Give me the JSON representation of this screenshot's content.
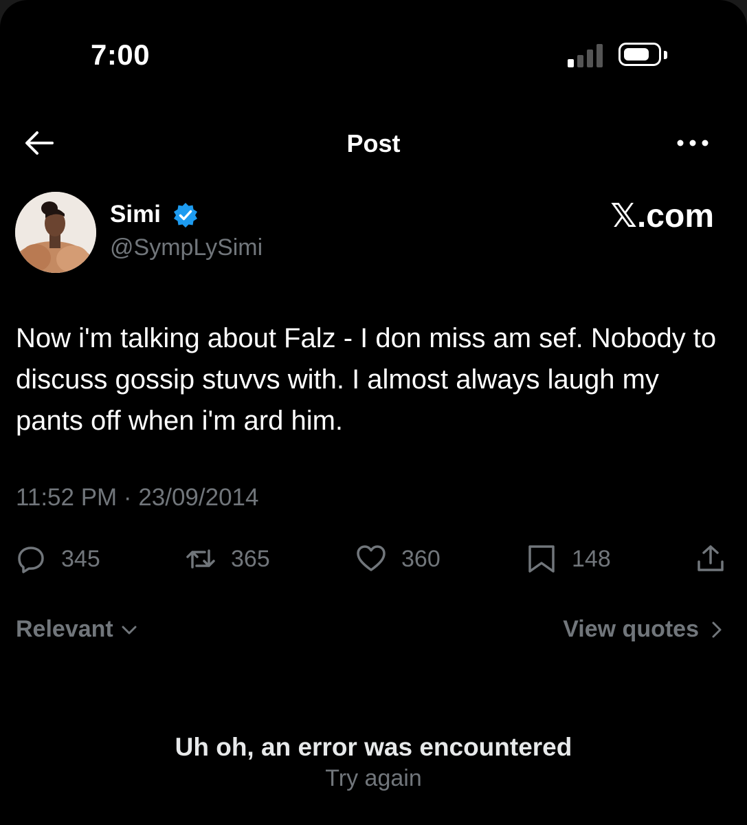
{
  "status_bar": {
    "time": "7:00"
  },
  "header": {
    "title": "Post"
  },
  "post": {
    "author_name": "Simi",
    "author_handle": "@SympLySimi",
    "watermark": "𝕏.com",
    "text": "Now i'm talking about Falz - I don miss am sef. Nobody to discuss gossip stuvvs with. I almost always laugh my pants off when i'm ard him.",
    "timestamp": "11:52 PM · 23/09/2014",
    "stats": {
      "replies": "345",
      "reposts": "365",
      "likes": "360",
      "bookmarks": "148"
    }
  },
  "filters": {
    "sort_label": "Relevant",
    "quotes_label": "View quotes"
  },
  "error": {
    "message": "Uh oh, an error was encountered",
    "retry_label": "Try again"
  },
  "colors": {
    "background": "#000000",
    "text": "#e7e9ea",
    "secondary": "#71767b",
    "verified": "#1d9bf0"
  }
}
